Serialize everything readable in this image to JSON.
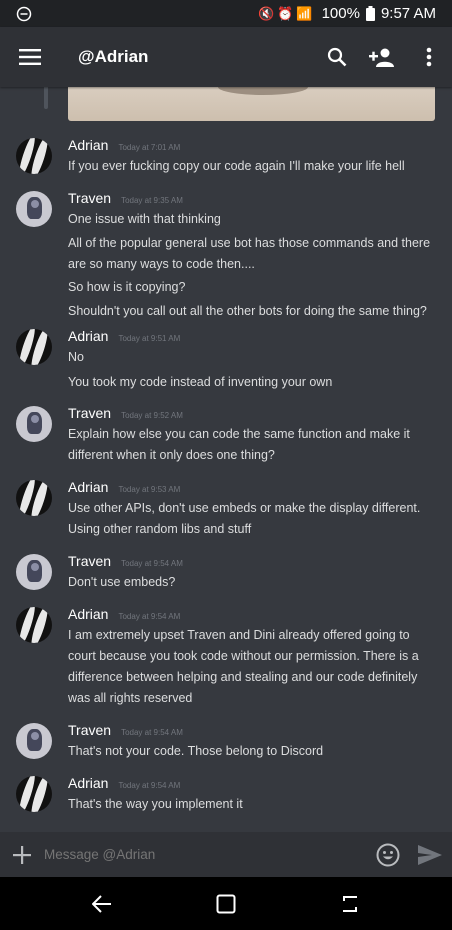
{
  "status_bar": {
    "battery": "100%",
    "time": "9:57 AM"
  },
  "header": {
    "title": "@Adrian"
  },
  "messages": [
    {
      "author": "Adrian",
      "timestamp": "Today at 7:01 AM",
      "avatar": "adrian-avatar",
      "lines": [
        "If you ever fucking copy our code again I'll make your life hell"
      ]
    },
    {
      "author": "Traven",
      "timestamp": "Today at 9:35 AM",
      "avatar": "traven-avatar",
      "lines": [
        "One issue with that thinking",
        "All of the popular general use bot has those commands and there",
        "are so many ways to code then....",
        "So how is it copying?",
        "Shouldn't you call out all the other bots for doing the same thing?"
      ]
    },
    {
      "author": "Adrian",
      "timestamp": "Today at 9:51 AM",
      "avatar": "adrian-avatar",
      "lines": [
        "No",
        "You took my code instead of inventing your own"
      ]
    },
    {
      "author": "Traven",
      "timestamp": "Today at 9:52 AM",
      "avatar": "traven-avatar",
      "lines": [
        "Explain how else you can code the same function and make it",
        "different when it only does one thing?"
      ]
    },
    {
      "author": "Adrian",
      "timestamp": "Today at 9:53 AM",
      "avatar": "adrian-avatar",
      "lines": [
        "Use other APIs, don't use embeds or make the display different.",
        "Using other random libs and stuff"
      ]
    },
    {
      "author": "Traven",
      "timestamp": "Today at 9:54 AM",
      "avatar": "traven-avatar",
      "lines": [
        "Don't use embeds?"
      ]
    },
    {
      "author": "Adrian",
      "timestamp": "Today at 9:54 AM",
      "avatar": "adrian-avatar",
      "lines": [
        "I am extremely upset Traven and Dini already offered going to",
        "court because you took code without our permission. There is a",
        "difference between helping and stealing and our code definitely",
        "was all rights reserved"
      ]
    },
    {
      "author": "Traven",
      "timestamp": "Today at 9:54 AM",
      "avatar": "traven-avatar",
      "lines": [
        "That's not your code. Those belong to Discord"
      ]
    },
    {
      "author": "Adrian",
      "timestamp": "Today at 9:54 AM",
      "avatar": "adrian-avatar",
      "lines": [
        "That's the way you implement it"
      ]
    }
  ],
  "composer": {
    "placeholder": "Message @Adrian"
  },
  "colors": {
    "background": "#36393f",
    "header": "#2f3136",
    "statusbar": "#202225",
    "timestamp": "#72767d"
  }
}
